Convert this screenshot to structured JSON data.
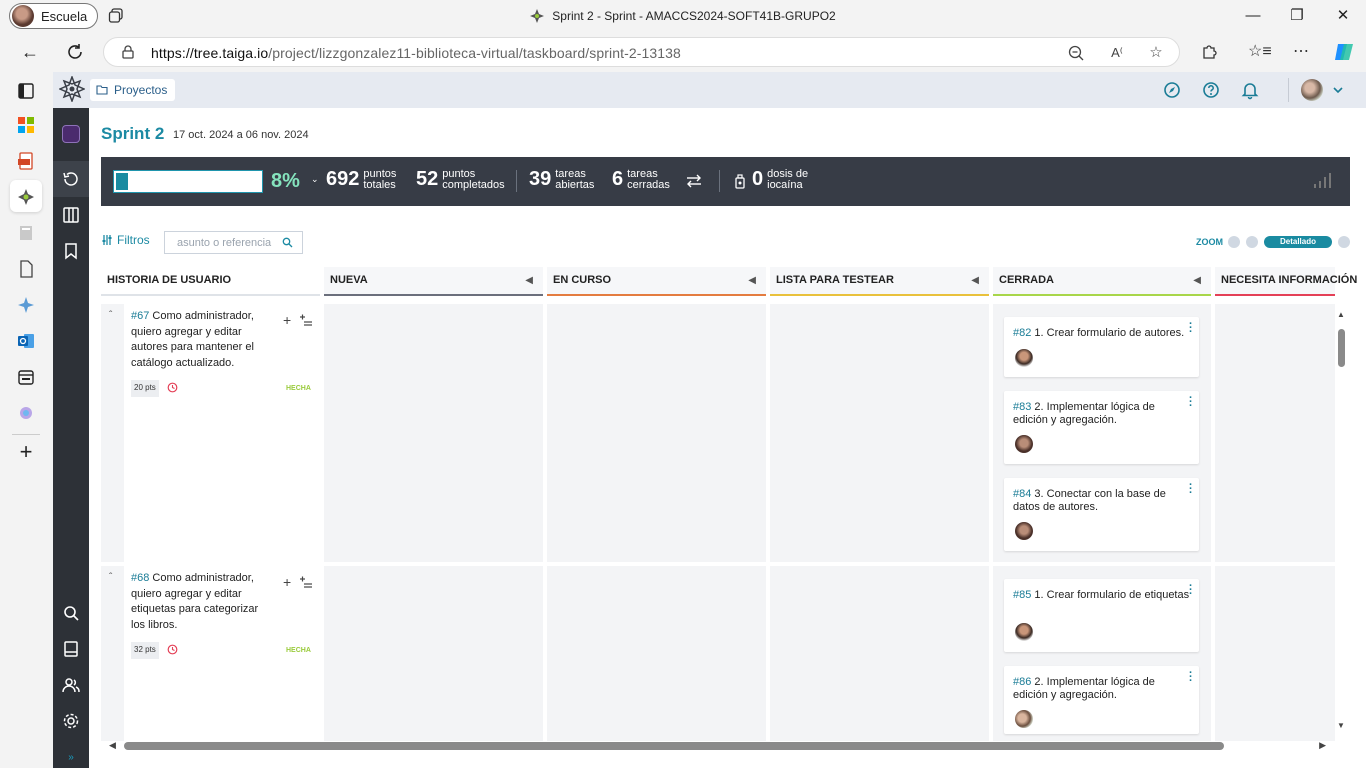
{
  "browser": {
    "profile_name": "Escuela",
    "window_title": "Sprint 2 - Sprint - AMACCS2024-SOFT41B-GRUPO2",
    "url_host": "https://tree.taiga.io",
    "url_path": "/project/lizzgonzalez11-biblioteca-virtual/taskboard/sprint-2-13138"
  },
  "topbar": {
    "breadcrumb": "Proyectos"
  },
  "sprint": {
    "title": "Sprint 2",
    "dates": "17 oct. 2024 a 06 nov. 2024"
  },
  "stats": {
    "progress": 0.08,
    "percent": "8%",
    "total_points": "692",
    "total_points_label1": "puntos",
    "total_points_label2": "totales",
    "completed_points": "52",
    "completed_points_label1": "puntos",
    "completed_points_label2": "completados",
    "open_tasks": "39",
    "open_tasks_label1": "tareas",
    "open_tasks_label2": "abiertas",
    "closed_tasks": "6",
    "closed_tasks_label1": "tareas",
    "closed_tasks_label2": "cerradas",
    "iocaine": "0",
    "iocaine_label1": "dosis de",
    "iocaine_label2": "iocaína"
  },
  "filters": {
    "label": "Filtros",
    "search_placeholder": "asunto o referencia",
    "zoom_label": "ZOOM",
    "zoom_selected": "Detallado"
  },
  "board": {
    "columns": [
      {
        "label": "HISTORIA DE USUARIO",
        "color": ""
      },
      {
        "label": "NUEVA",
        "color": "#6b6f7c"
      },
      {
        "label": "EN CURSO",
        "color": "#e47c40"
      },
      {
        "label": "LISTA PARA TESTEAR",
        "color": "#e9c13c"
      },
      {
        "label": "CERRADA",
        "color": "#a8d64a"
      },
      {
        "label": "NECESITA INFORMACIÓN",
        "color": "#e44057"
      }
    ],
    "stories": [
      {
        "ref": "#67",
        "text": "Como administrador, quiero agregar y editar autores para mantener el catálogo actualizado.",
        "points": "20 pts",
        "status": "HECHA",
        "tasks": [
          {
            "ref": "#82",
            "text": "1. Crear formulario de autores."
          },
          {
            "ref": "#83",
            "text": "2. Implementar lógica de edición y agregación."
          },
          {
            "ref": "#84",
            "text": "3. Conectar con la base de datos de autores."
          }
        ]
      },
      {
        "ref": "#68",
        "text": "Como administrador, quiero agregar y editar etiquetas para categorizar los libros.",
        "points": "32 pts",
        "status": "HECHA",
        "tasks": [
          {
            "ref": "#85",
            "text": "1. Crear formulario de etiquetas"
          },
          {
            "ref": "#86",
            "text": "2. Implementar lógica de edición y agregación."
          }
        ]
      }
    ]
  }
}
